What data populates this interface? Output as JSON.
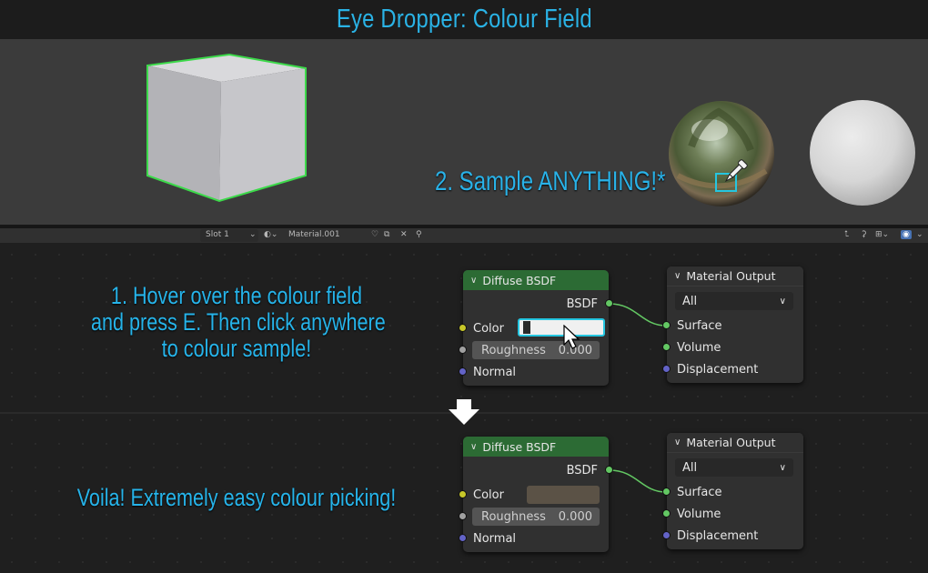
{
  "title": "Eye Dropper: Colour Field",
  "viewport": {
    "sample_caption": "2. Sample ANYTHING!*"
  },
  "header": {
    "slot": "Slot 1",
    "material": "Material.001"
  },
  "captions": {
    "step1_line1": "1. Hover over the colour field",
    "step1_line2": "and press E. Then click anywhere",
    "step1_line3": "to colour sample!",
    "step2": "Voila! Extremely easy colour picking!"
  },
  "nodes_top": {
    "diffuse": {
      "title": "Diffuse BSDF",
      "output": "BSDF",
      "color_label": "Color",
      "roughness_label": "Roughness",
      "roughness_value": "0.000",
      "normal_label": "Normal"
    },
    "output": {
      "title": "Material Output",
      "target": "All",
      "surface": "Surface",
      "volume": "Volume",
      "displacement": "Displacement"
    }
  },
  "nodes_bottom": {
    "diffuse": {
      "title": "Diffuse BSDF",
      "output": "BSDF",
      "color_label": "Color",
      "roughness_label": "Roughness",
      "roughness_value": "0.000",
      "normal_label": "Normal",
      "color_swatch": "#5b5246"
    },
    "output": {
      "title": "Material Output",
      "target": "All",
      "surface": "Surface",
      "volume": "Volume",
      "displacement": "Displacement"
    }
  },
  "colors": {
    "accent": "#29b2e8",
    "node_header_shader": "#2c6b34",
    "selection_outline": "#3cd94a"
  }
}
